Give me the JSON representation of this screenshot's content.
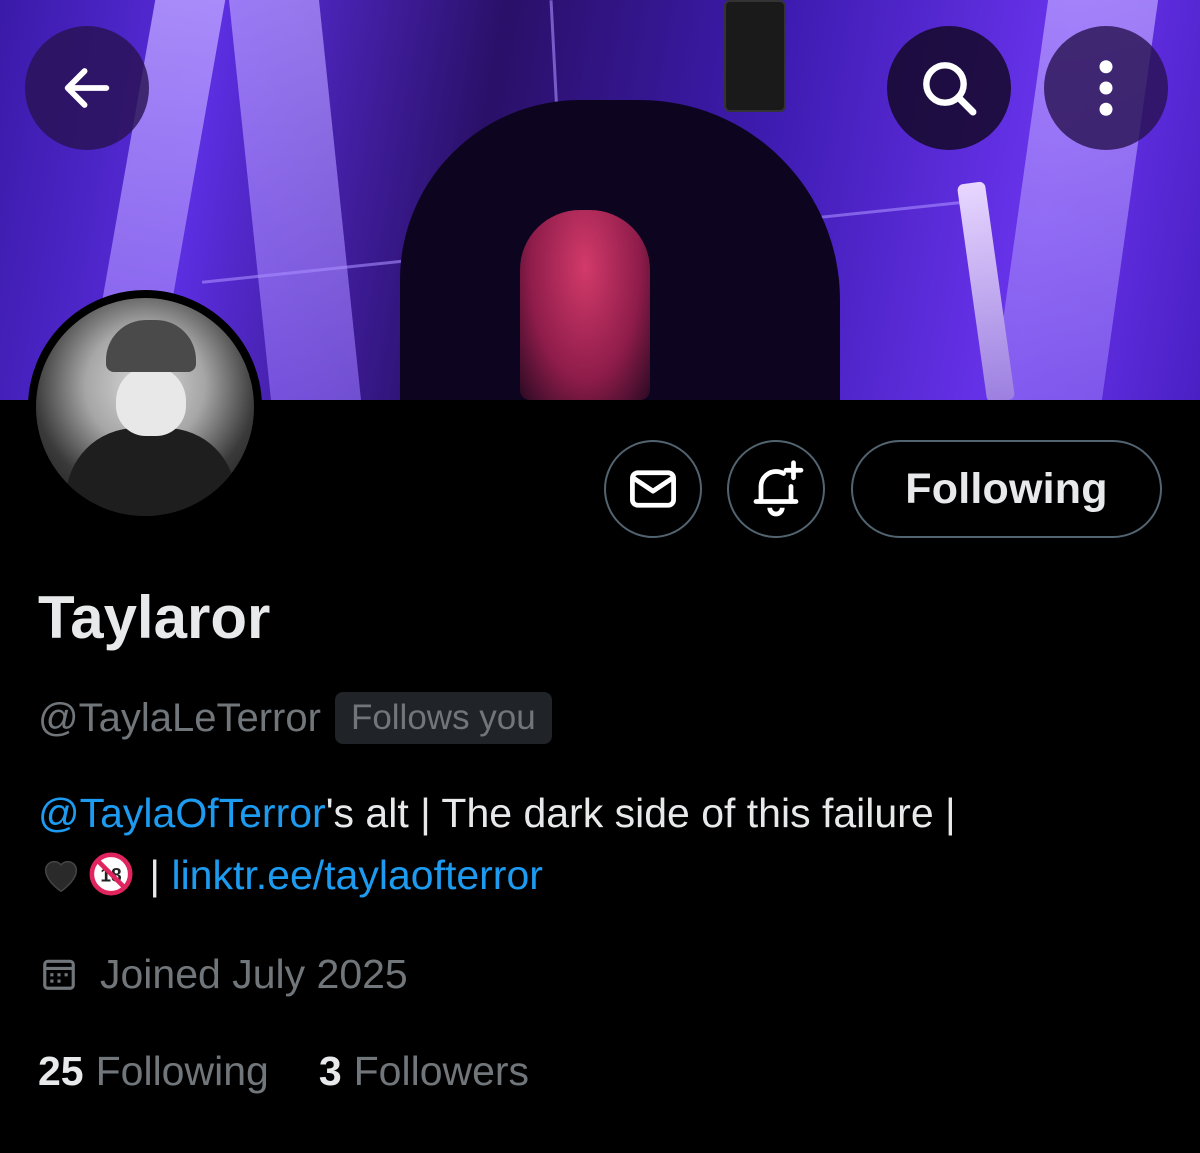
{
  "profile": {
    "display_name": "Taylaror",
    "handle": "@TaylaLeTerror",
    "follows_you_badge": "Follows you",
    "bio": {
      "mention": "@TaylaOfTerror",
      "text_after_mention": "'s alt | The dark side of this failure |",
      "separator": "|",
      "link": "linktr.ee/taylaofterror",
      "emojis": [
        "black-heart",
        "no-one-under-eighteen"
      ]
    },
    "joined": "Joined July 2025",
    "stats": {
      "following_count": "25",
      "following_label": "Following",
      "followers_count": "3",
      "followers_label": "Followers"
    }
  },
  "actions": {
    "following_label": "Following",
    "message_icon": "envelope-icon",
    "notify_icon": "bell-plus-icon"
  },
  "header": {
    "back_icon": "arrow-left-icon",
    "search_icon": "search-icon",
    "more_icon": "more-vertical-icon"
  },
  "colors": {
    "background": "#000000",
    "primary_text": "#e7e9ea",
    "secondary_text": "#71767b",
    "link": "#1d9bf0",
    "border": "#536471",
    "banner_accent": "#5b2ee0"
  }
}
